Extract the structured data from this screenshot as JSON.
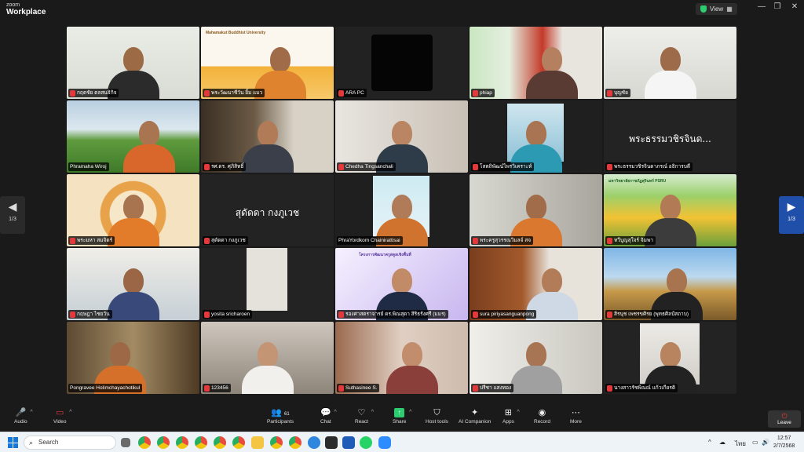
{
  "app": {
    "brand_top": "zoom",
    "brand_bottom": "Workplace",
    "view_label": "View"
  },
  "pager": {
    "left": "1/3",
    "right": "1/3"
  },
  "tiles": [
    {
      "name": "กฤตชัย ตลสนธิกิจ",
      "speaking": true
    },
    {
      "name": "พระวัฒนาชีวัน ยิ้ม แมว",
      "banner": "Mahamakut Buddhist University"
    },
    {
      "name": "ARA PC"
    },
    {
      "name": "phiap"
    },
    {
      "name": "บุญชัย"
    },
    {
      "name": "Phramaha Wiroj"
    },
    {
      "name": "รศ.ดร. ศุภิสิทธิ์"
    },
    {
      "name": "Chedha Tingsanchali"
    },
    {
      "name": "โสตถิพัฒน์ไพรวิเคราะห์"
    },
    {
      "name": "พระธรรมวชิรจินดาภรณ์ อธิการบดี",
      "center_text": "พระธรรมวชิรจินด..."
    },
    {
      "name": "พระมหา สมจิตร์"
    },
    {
      "name": "สุดัดดา กงภูเวช",
      "center_text": "สุดัดดา กงภูเวช"
    },
    {
      "name": "PhraYordkom Chainirattisai"
    },
    {
      "name": "พระครูสุวรรณวิมลจ์ สจ"
    },
    {
      "name": "ทวีบูญสุใจร์ จิมพา",
      "banner": "มหาวิทยาลัยราชภัฏสุรินทร์ PSRU"
    },
    {
      "name": "กฤษฎา ไชยวัน"
    },
    {
      "name": "yosita sricharoen"
    },
    {
      "name": "รองศาสตราจารย์ ดร.พิณสุดา สิริธรังศรี (มมร)",
      "banner": "โครงการพัฒนาครูสตูลเชิงพื้นที่"
    },
    {
      "name": "sura piriyasanguanpong"
    },
    {
      "name": "สิรนุช เพชรขศิรย (พุทธศิลป์สถาบ)"
    },
    {
      "name": "Pongravee Holimchayachotikul"
    },
    {
      "name": "123456"
    },
    {
      "name": "Suthasinee S."
    },
    {
      "name": "ปรีชา แสงทอง"
    },
    {
      "name": "นางสาวรัชพิณณ์ แก้วเกียรติ"
    }
  ],
  "toolbar": {
    "audio": "Audio",
    "video": "Video",
    "participants": "Participants",
    "participants_count": "61",
    "chat": "Chat",
    "react": "React",
    "share": "Share",
    "host_tools": "Host tools",
    "ai_companion": "AI Companion",
    "apps": "Apps",
    "record": "Record",
    "more": "More",
    "leave": "Leave"
  },
  "taskbar": {
    "search_placeholder": "Search",
    "lang": "ไทย",
    "time": "12:57",
    "date": "2/7/2568"
  },
  "colors": {
    "accent_green": "#3fcf6f",
    "share_green": "#2ecc71",
    "leave_red": "#e5383b",
    "pager_blue": "#1f4fa8"
  }
}
